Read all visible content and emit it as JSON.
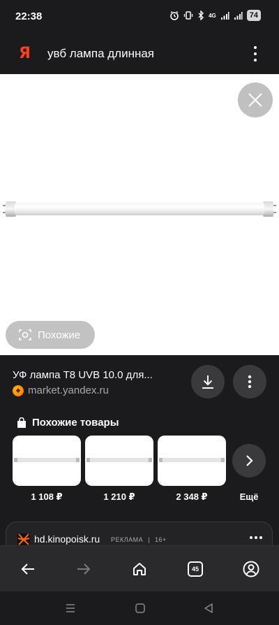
{
  "status_bar": {
    "time": "22:38",
    "network": "4G",
    "battery": "74",
    "icons": [
      "alarm-icon",
      "vibrate-icon",
      "bluetooth-icon",
      "signal-icon",
      "signal-icon"
    ]
  },
  "header": {
    "logo": "Я",
    "query": "увб лампа длинная",
    "menu_icon": "more-vertical-icon"
  },
  "viewer": {
    "close_icon": "close-icon",
    "similar_button_label": "Похожие",
    "similar_icon": "camera-search-icon"
  },
  "result": {
    "title": "УФ лампа T8 UVB 10.0 для...",
    "source": "market.yandex.ru",
    "download_icon": "download-icon",
    "more_icon": "more-vertical-icon"
  },
  "similar_products": {
    "heading": "Похожие товары",
    "heading_icon": "shopping-bag-icon",
    "items": [
      {
        "price": "1 108 ₽"
      },
      {
        "price": "1 210 ₽"
      },
      {
        "price": "2 348 ₽"
      }
    ],
    "more_label": "Ещё",
    "more_icon": "chevron-right-icon"
  },
  "ad": {
    "domain": "hd.kinopoisk.ru",
    "label": "РЕКЛАМА",
    "separator": "|",
    "age": "16+",
    "more_icon": "more-horizontal-icon"
  },
  "bottom_nav": {
    "back_icon": "arrow-left-icon",
    "forward_icon": "arrow-right-icon",
    "home_icon": "home-icon",
    "tabs_count": "45",
    "profile_icon": "profile-icon"
  },
  "system_nav": {
    "recents_icon": "recents-icon",
    "home_icon": "home-square-icon",
    "back_icon": "back-triangle-icon"
  },
  "colors": {
    "background": "#1b1b1d",
    "brand_red": "#fc3f1d",
    "muted_text": "#a9a9ad",
    "button_bg": "#3a3a3d"
  }
}
